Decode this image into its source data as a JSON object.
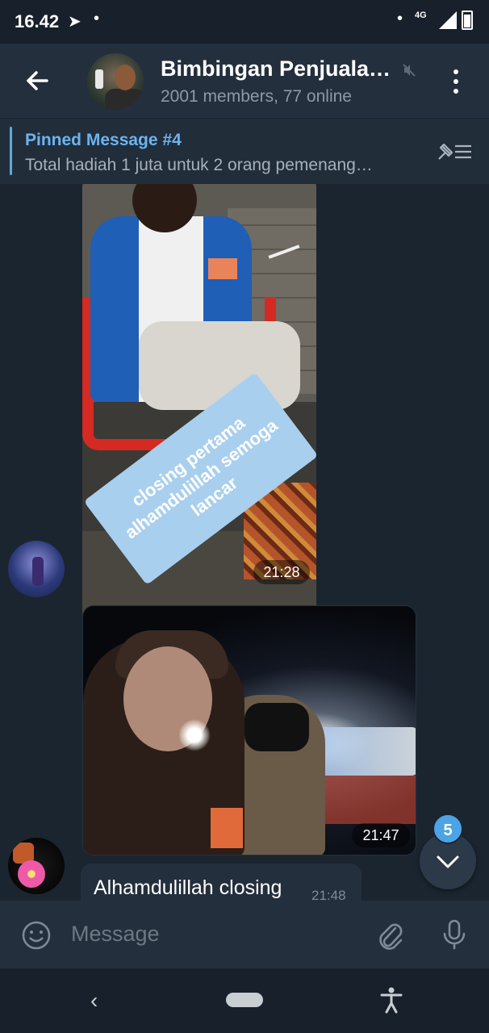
{
  "status_bar": {
    "time": "16.42",
    "network": "4G"
  },
  "header": {
    "title": "Bimbingan Penjuala…",
    "subtitle": "2001 members, 77 online"
  },
  "pinned": {
    "title": "Pinned Message #4",
    "text": "Total hadiah 1 juta untuk 2 orang pemenang…"
  },
  "messages": [
    {
      "type": "photo",
      "sticker_text": "closing pertama alhamdulillah semoga lancar",
      "time": "21:28"
    },
    {
      "type": "photo",
      "time": "21:47"
    },
    {
      "type": "text",
      "text": "Alhamdulillah closing",
      "time": "21:48"
    }
  ],
  "scroll": {
    "unread_count": "5"
  },
  "composer": {
    "placeholder": "Message"
  },
  "colors": {
    "accent": "#6cb4ef",
    "badge": "#4ca3e6",
    "background": "#1d2733",
    "header": "#242f3d"
  },
  "icons": [
    "back-arrow-icon",
    "mute-icon",
    "more-vertical-icon",
    "pin-list-icon",
    "emoji-icon",
    "attach-icon",
    "mic-icon",
    "chevron-down-icon",
    "nav-back-icon",
    "home-pill-icon",
    "accessibility-icon"
  ]
}
